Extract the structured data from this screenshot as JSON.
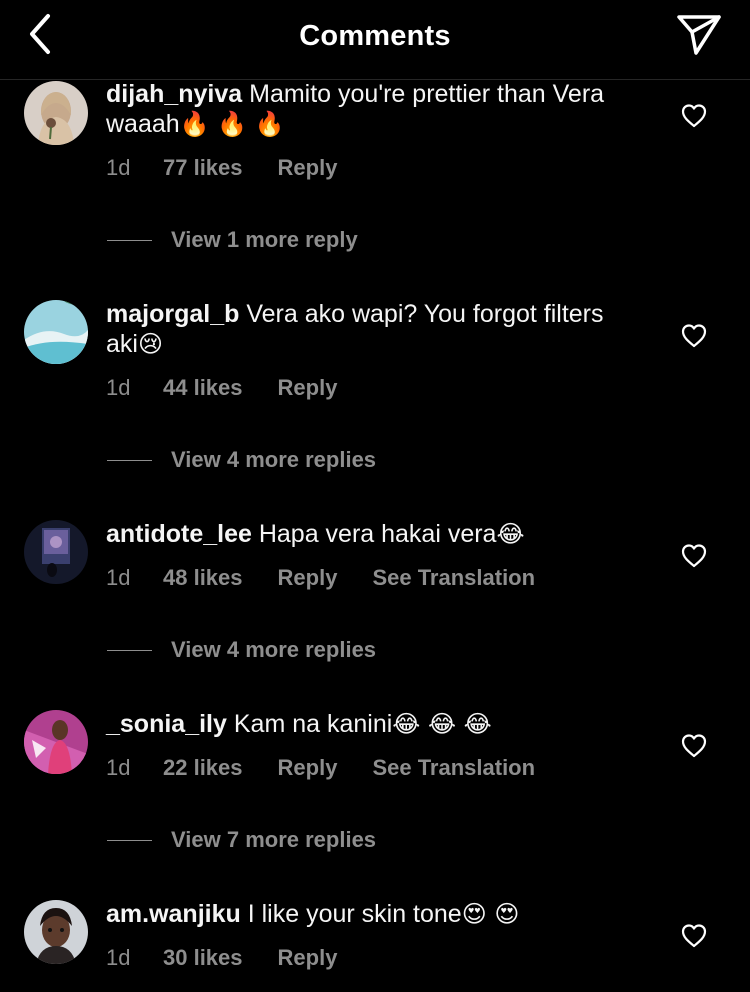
{
  "header": {
    "title": "Comments"
  },
  "comments": [
    {
      "username": "dijah_nyiva",
      "text": "Mamito you're prettier than Vera waaah",
      "emojis": "🔥 🔥 🔥",
      "time": "1d",
      "likes": "77 likes",
      "reply": "Reply",
      "view_replies": "View 1 more reply"
    },
    {
      "username": "majorgal_b",
      "text": "Vera ako wapi? You forgot filters aki",
      "emojis": "😢",
      "time": "1d",
      "likes": "44 likes",
      "reply": "Reply",
      "view_replies": "View 4 more replies"
    },
    {
      "username": "antidote_lee",
      "text": "Hapa vera hakai vera",
      "emojis": "😂",
      "time": "1d",
      "likes": "48 likes",
      "reply": "Reply",
      "translation": "See Translation",
      "view_replies": "View 4 more replies"
    },
    {
      "username": "_sonia_ily",
      "text": "Kam na kanini",
      "emojis": "😂 😂 😂",
      "time": "1d",
      "likes": "22 likes",
      "reply": "Reply",
      "translation": "See Translation",
      "view_replies": "View 7 more replies"
    },
    {
      "username": "am.wanjiku",
      "text": "I like your skin tone",
      "emojis": "😍 😍",
      "time": "1d",
      "likes": "30 likes",
      "reply": "Reply"
    }
  ],
  "icons": {
    "back": "chevron-left-icon",
    "send": "paper-plane-icon",
    "like": "heart-outline-icon"
  },
  "colors": {
    "background": "#000000",
    "primary_text": "#ffffff",
    "secondary_text": "#8e8e8e",
    "divider": "#262626"
  }
}
